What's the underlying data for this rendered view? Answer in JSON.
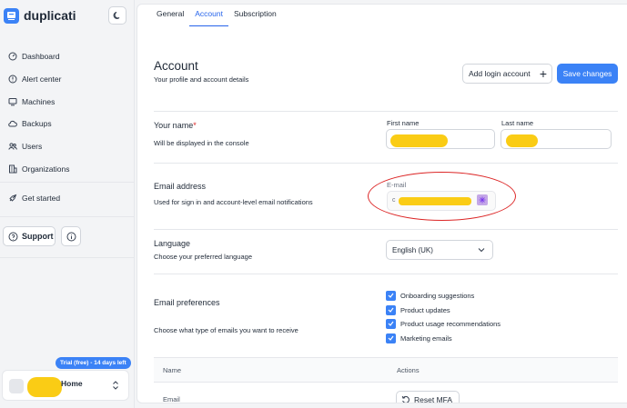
{
  "app": {
    "name": "duplicati"
  },
  "sidebar": {
    "items": [
      {
        "label": "Dashboard",
        "icon": "dashboard-icon"
      },
      {
        "label": "Alert center",
        "icon": "alert-icon"
      },
      {
        "label": "Machines",
        "icon": "machines-icon"
      },
      {
        "label": "Backups",
        "icon": "backups-icon"
      },
      {
        "label": "Users",
        "icon": "users-icon"
      },
      {
        "label": "Organizations",
        "icon": "organizations-icon"
      }
    ],
    "get_started": "Get started",
    "support": "Support",
    "trial_badge": "Trial (free) - 14 days left",
    "org_label": "Home"
  },
  "tabs": [
    {
      "label": "General",
      "active": false
    },
    {
      "label": "Account",
      "active": true
    },
    {
      "label": "Subscription",
      "active": false
    }
  ],
  "account": {
    "title": "Account",
    "subtitle": "Your profile and account details",
    "add_login_label": "Add login account",
    "save_label": "Save changes"
  },
  "name_section": {
    "title": "Your name",
    "required_marker": "*",
    "subtitle": "Will be displayed in the console",
    "first_name_label": "First name",
    "last_name_label": "Last name"
  },
  "email_section": {
    "title": "Email address",
    "subtitle": "Used for sign in and account-level email notifications",
    "field_label": "E-mail",
    "value_prefix": "c"
  },
  "language_section": {
    "title": "Language",
    "subtitle": "Choose your preferred language",
    "selected": "English (UK)"
  },
  "email_prefs": {
    "title": "Email preferences",
    "subtitle": "Choose what type of emails you want to receive",
    "options": [
      {
        "label": "Onboarding suggestions",
        "checked": true
      },
      {
        "label": "Product updates",
        "checked": true
      },
      {
        "label": "Product usage recommendations",
        "checked": true
      },
      {
        "label": "Marketing emails",
        "checked": true
      }
    ]
  },
  "logins_table": {
    "columns": [
      "Name",
      "Actions"
    ],
    "rows": [
      {
        "name": "Email",
        "action": "Reset MFA"
      }
    ]
  },
  "colors": {
    "accent": "#3b82f6",
    "redaction": "#facc15",
    "annotation": "#dc2626"
  }
}
